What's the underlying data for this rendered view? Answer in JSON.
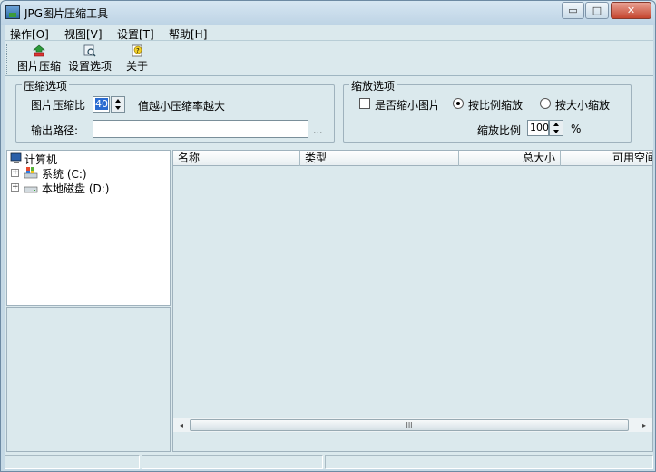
{
  "window": {
    "title": "JPG图片压缩工具",
    "min_glyph": "▭",
    "max_glyph": "□",
    "close_glyph": "✕"
  },
  "menu": [
    "操作[O]",
    "视图[V]",
    "设置[T]",
    "帮助[H]"
  ],
  "toolbar": {
    "compress_label": "图片压缩",
    "settings_label": "设置选项",
    "about_label": "关于"
  },
  "compress_options": {
    "legend": "压缩选项",
    "ratio_label": "图片压缩比",
    "ratio_value": "40",
    "ratio_hint": "值越小压缩率越大",
    "output_label": "输出路径:",
    "output_value": "",
    "browse_label": "..."
  },
  "scale_options": {
    "legend": "缩放选项",
    "shrink_label": "是否缩小图片",
    "shrink_checked": false,
    "by_ratio_label": "按比例缩放",
    "by_ratio_selected": true,
    "by_size_label": "按大小缩放",
    "scale_ratio_label": "缩放比例",
    "scale_ratio_value": "100",
    "percent_label": "%"
  },
  "tree": {
    "root": "计算机",
    "items": [
      "系统 (C:)",
      "本地磁盘 (D:)"
    ]
  },
  "list": {
    "columns": [
      "名称",
      "类型",
      "总大小",
      "可用空间"
    ]
  },
  "hscroll": {
    "left_arrow": "◂",
    "right_arrow": "▸",
    "thumb_grip": "III"
  },
  "colors": {
    "background": "#dbe9ed",
    "title_bar": "#c5d9e5",
    "close_button": "#c5462f",
    "selection": "#2a6bd1"
  }
}
